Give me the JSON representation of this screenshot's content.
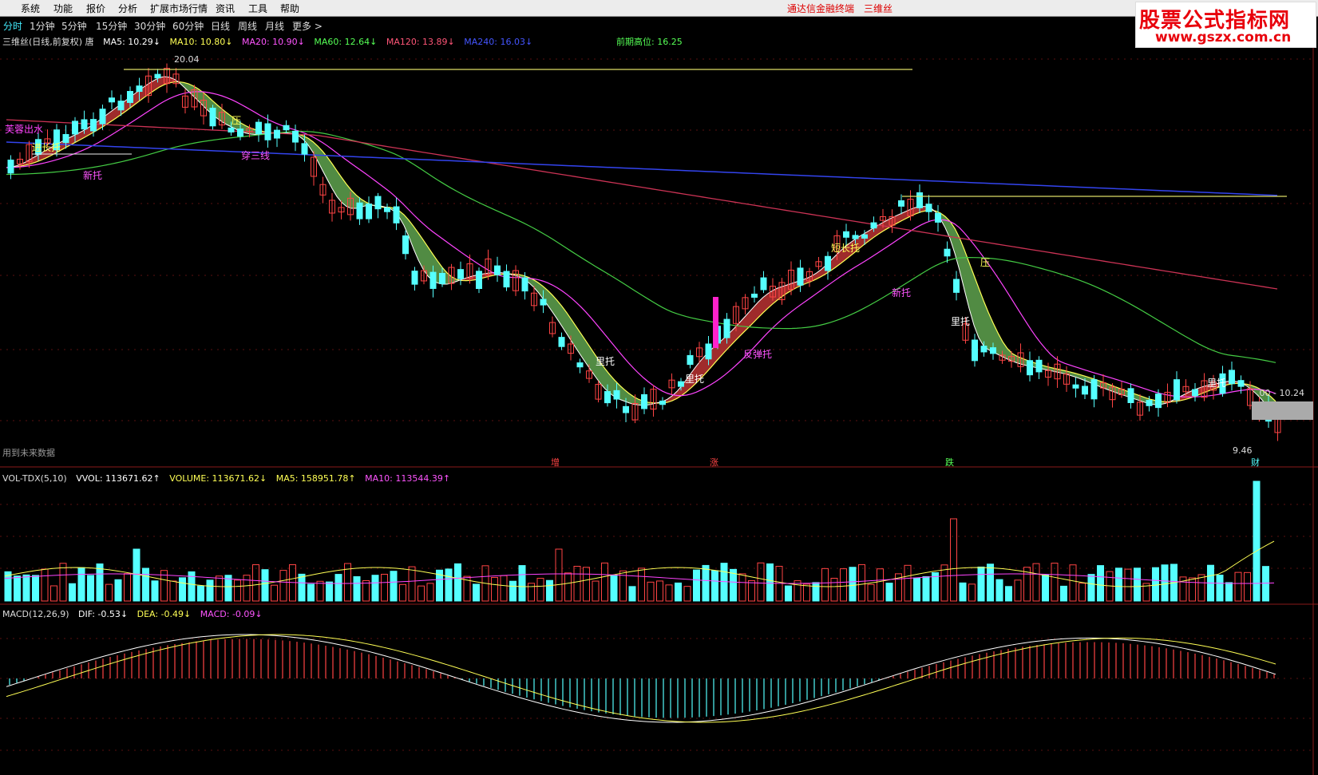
{
  "menu": {
    "items": [
      "系统",
      "功能",
      "报价",
      "分析",
      "扩展市场行情",
      "资讯",
      "工具",
      "帮助"
    ],
    "window_title": "通达信金融终端　三维丝"
  },
  "logo": {
    "line1": "股票公式指标网",
    "line2": "www.gszx.com.cn"
  },
  "periods": [
    "分时",
    "1分钟",
    "5分钟",
    "15分钟",
    "30分钟",
    "60分钟",
    "日线",
    "周线",
    "月线",
    "更多 >"
  ],
  "main_panel": {
    "stock_label": "三维丝(日线,前复权) 唐",
    "ma": [
      {
        "text": "MA5: 10.29↓",
        "color": "#ffffff"
      },
      {
        "text": "MA10: 10.80↓",
        "color": "#ffff55"
      },
      {
        "text": "MA20: 10.90↓",
        "color": "#ff55ff"
      },
      {
        "text": "MA60: 12.64↓",
        "color": "#55ff55"
      },
      {
        "text": "MA120: 13.89↓",
        "color": "#ff5577"
      },
      {
        "text": "MA240: 16.03↓",
        "color": "#4455ff"
      }
    ],
    "prev_high": "前期高位: 16.25",
    "high_label": "20.04",
    "low_label": "9.46",
    "range_label": ".00 - 10.24",
    "future_data": "用到未来数据",
    "annotations": [
      "芙蓉出水",
      "进长托",
      "新托",
      "穿三线",
      "里托",
      "短长托",
      "反弹托",
      "压",
      "压"
    ],
    "bottom_marks": [
      "增",
      "涨",
      "跌",
      "财"
    ]
  },
  "vol_panel": {
    "label": "VOL-TDX(5,10)",
    "values": [
      {
        "text": "VVOL: 113671.62↑",
        "color": "#ffffff"
      },
      {
        "text": "VOLUME: 113671.62↓",
        "color": "#ffff55"
      },
      {
        "text": "MA5: 158951.78↑",
        "color": "#ffff55"
      },
      {
        "text": "MA10: 113544.39↑",
        "color": "#ff55ff"
      }
    ]
  },
  "macd_panel": {
    "label": "MACD(12,26,9)",
    "values": [
      {
        "text": "DIF: -0.53↓",
        "color": "#ffffff"
      },
      {
        "text": "DEA: -0.49↓",
        "color": "#ffff55"
      },
      {
        "text": "MACD: -0.09↓",
        "color": "#ff55ff"
      }
    ]
  },
  "colors": {
    "up": "#ff4444",
    "down": "#55ffff",
    "ma5": "#ffffff",
    "ma10": "#ffff55",
    "ma20": "#ff44ff",
    "ma60": "#44cc44",
    "ma120": "#cc3355",
    "ma240": "#3344ee",
    "band_up": "#b03030",
    "band_down": "#5a9a4a"
  }
}
